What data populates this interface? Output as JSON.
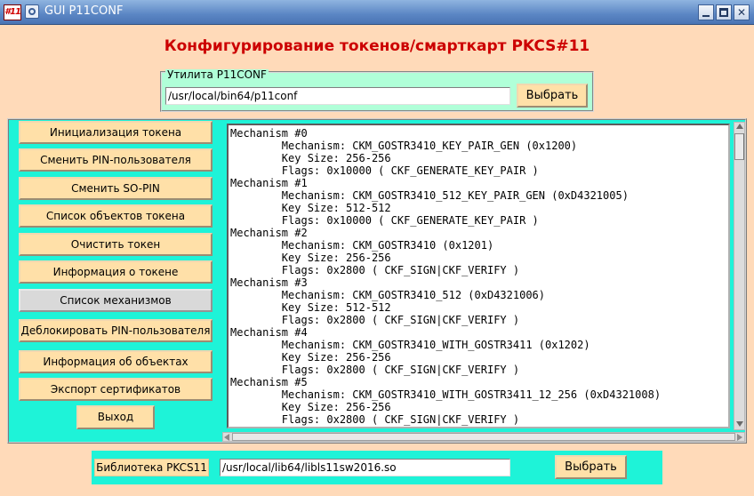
{
  "window": {
    "app_icon_text": "#11",
    "title": "GUI P11CONF"
  },
  "header": {
    "title": "Конфигурирование токенов/смарткарт PKCS#11"
  },
  "utility": {
    "legend": "Утилита P11CONF",
    "path_value": "/usr/local/bin64/p11conf",
    "browse_label": "Выбрать"
  },
  "sidebar": {
    "buttons": [
      {
        "label": "Инициализация токена"
      },
      {
        "label": "Сменить PIN-пользователя"
      },
      {
        "label": "Сменить SO-PIN"
      },
      {
        "label": "Список объектов токена"
      },
      {
        "label": "Очистить токен"
      },
      {
        "label": "Информация о токене"
      },
      {
        "label": "Список механизмов",
        "active": true
      },
      {
        "label": "Деблокировать PIN-пользователя"
      },
      {
        "label": "Информация об объектах"
      },
      {
        "label": "Экспорт сертификатов"
      }
    ],
    "exit_label": "Выход"
  },
  "output": {
    "text": "Mechanism #0\n        Mechanism: CKM_GOSTR3410_KEY_PAIR_GEN (0x1200)\n        Key Size: 256-256\n        Flags: 0x10000 ( CKF_GENERATE_KEY_PAIR )\nMechanism #1\n        Mechanism: CKM_GOSTR3410_512_KEY_PAIR_GEN (0xD4321005)\n        Key Size: 512-512\n        Flags: 0x10000 ( CKF_GENERATE_KEY_PAIR )\nMechanism #2\n        Mechanism: CKM_GOSTR3410 (0x1201)\n        Key Size: 256-256\n        Flags: 0x2800 ( CKF_SIGN|CKF_VERIFY )\nMechanism #3\n        Mechanism: CKM_GOSTR3410_512 (0xD4321006)\n        Key Size: 512-512\n        Flags: 0x2800 ( CKF_SIGN|CKF_VERIFY )\nMechanism #4\n        Mechanism: CKM_GOSTR3410_WITH_GOSTR3411 (0x1202)\n        Key Size: 256-256\n        Flags: 0x2800 ( CKF_SIGN|CKF_VERIFY )\nMechanism #5\n        Mechanism: CKM_GOSTR3410_WITH_GOSTR3411_12_256 (0xD4321008)\n        Key Size: 256-256\n        Flags: 0x2800 ( CKF_SIGN|CKF_VERIFY )"
  },
  "library": {
    "label": "Библиотека PKCS11",
    "path_value": "/usr/local/lib64/libls11sw2016.so",
    "browse_label": "Выбрать"
  },
  "colors": {
    "background": "#ffdab9",
    "panel": "#1ef3d8",
    "utility_frame": "#b0ffd8",
    "button": "#ffe0a8",
    "title_text": "#cc0000"
  }
}
